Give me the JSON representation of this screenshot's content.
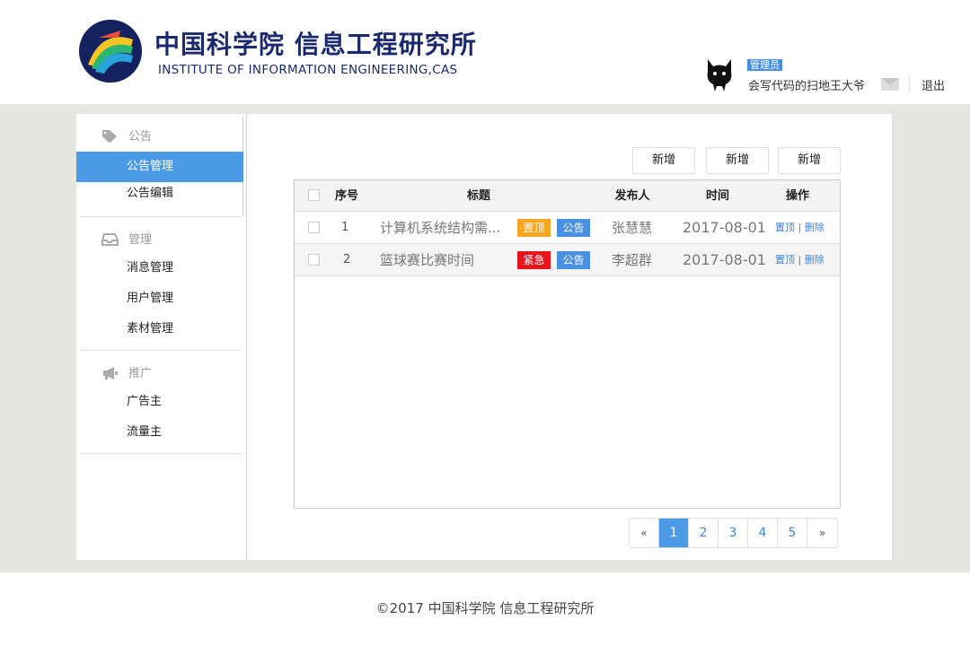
{
  "header": {
    "logo_cn": "中国科学院 信息工程研究所",
    "logo_en": "INSTITUTE OF INFORMATION ENGINEERING,CAS",
    "role_badge": "管理员",
    "user_name": "会写代码的扫地王大爷",
    "logout": "退出"
  },
  "sidebar": {
    "sections": [
      {
        "title": "公告",
        "icon": "tags-icon",
        "items": [
          "公告管理",
          "公告编辑"
        ]
      },
      {
        "title": "管理",
        "icon": "inbox-icon",
        "items": [
          "消息管理",
          "用户管理",
          "素材管理"
        ]
      },
      {
        "title": "推广",
        "icon": "bullhorn-icon",
        "items": [
          "广告主",
          "流量主"
        ]
      }
    ],
    "active_item": "公告管理"
  },
  "toolbar": {
    "buttons": [
      "新增",
      "新增",
      "新增"
    ]
  },
  "table": {
    "headers": [
      "序号",
      "标题",
      "发布人",
      "时间",
      "操作"
    ],
    "rows": [
      {
        "index": "1",
        "title": "计算机系统结构需...",
        "tags": [
          "置顶",
          "公告"
        ],
        "author": "张慧慧",
        "date": "2017-08-01",
        "op_top": "置顶",
        "op_sep": "|",
        "op_delete": "删除"
      },
      {
        "index": "2",
        "title": "篮球赛比赛时间",
        "tags": [
          "紧急",
          "公告"
        ],
        "author": "李超群",
        "date": "2017-08-01",
        "op_top": "置顶",
        "op_sep": "|",
        "op_delete": "删除"
      }
    ]
  },
  "pagination": {
    "prev": "«",
    "pages": [
      "1",
      "2",
      "3",
      "4",
      "5"
    ],
    "next": "»",
    "current": "1"
  },
  "footer": {
    "text": "©2017 中国科学院 信息工程研究所"
  },
  "colors": {
    "accent": "#4a9ae6",
    "tag_top": "#f5a623",
    "tag_urgent": "#e8141c",
    "tag_notice": "#4a90e2",
    "band": "#e6e6e0"
  }
}
